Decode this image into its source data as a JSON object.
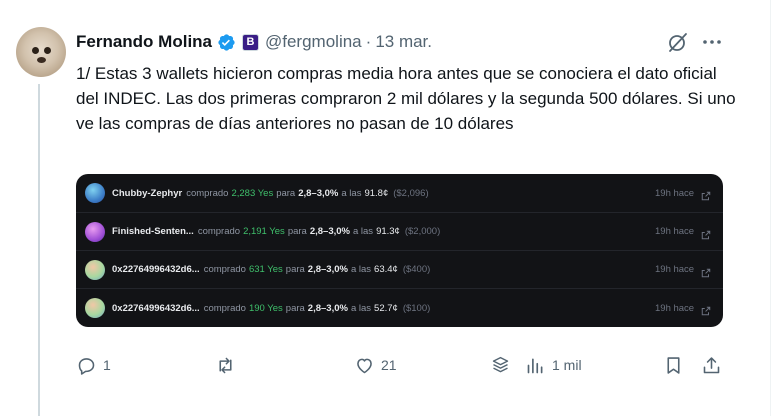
{
  "tweet": {
    "author_name": "Fernando Molina",
    "author_badge_letter": "B",
    "handle": "@fergmolina",
    "separator": "·",
    "date": "13 mar.",
    "text": "1/ Estas 3 wallets hicieron compras media hora antes que se conociera el dato oficial del INDEC. Las dos primeras compraron 2 mil dólares y la segunda 500 dólares. Si uno ve las compras de días anteriores no pasan de 10 dólares"
  },
  "card": {
    "rows": [
      {
        "user": "Chubby-Zephyr",
        "verb": "comprado",
        "amount": "2,283 Yes",
        "para": "para",
        "range": "2,8–3,0%",
        "a_las": "a las",
        "price": "91.8¢",
        "usd": "($2,096)",
        "time": "19h hace",
        "avatar_color": "#4f9fd8"
      },
      {
        "user": "Finished-Senten...",
        "verb": "comprado",
        "amount": "2,191 Yes",
        "para": "para",
        "range": "2,8–3,0%",
        "a_las": "a las",
        "price": "91.3¢",
        "usd": "($2,000)",
        "time": "19h hace",
        "avatar_color": "#b35be0"
      },
      {
        "user": "0x22764996432d6...",
        "verb": "comprado",
        "amount": "631 Yes",
        "para": "para",
        "range": "2,8–3,0%",
        "a_las": "a las",
        "price": "63.4¢",
        "usd": "($400)",
        "time": "19h hace",
        "avatar_color": "#9fcf9a"
      },
      {
        "user": "0x22764996432d6...",
        "verb": "comprado",
        "amount": "190 Yes",
        "para": "para",
        "range": "2,8–3,0%",
        "a_las": "a las",
        "price": "52.7¢",
        "usd": "($100)",
        "time": "19h hace",
        "avatar_color": "#9fcf9a"
      }
    ]
  },
  "actions": {
    "replies": "1",
    "retweets": "",
    "likes": "21",
    "views": "1 mil"
  },
  "colors": {
    "accent": "#1d9bf0",
    "text": "#0f1419",
    "muted": "#536471",
    "card_bg": "#121316",
    "green": "#3fbf6b"
  },
  "icons": [
    "verified-icon",
    "grok-icon",
    "more-icon",
    "reply-icon",
    "retweet-icon",
    "like-icon",
    "stack-icon",
    "views-icon",
    "bookmark-icon",
    "share-icon",
    "external-link-icon"
  ]
}
